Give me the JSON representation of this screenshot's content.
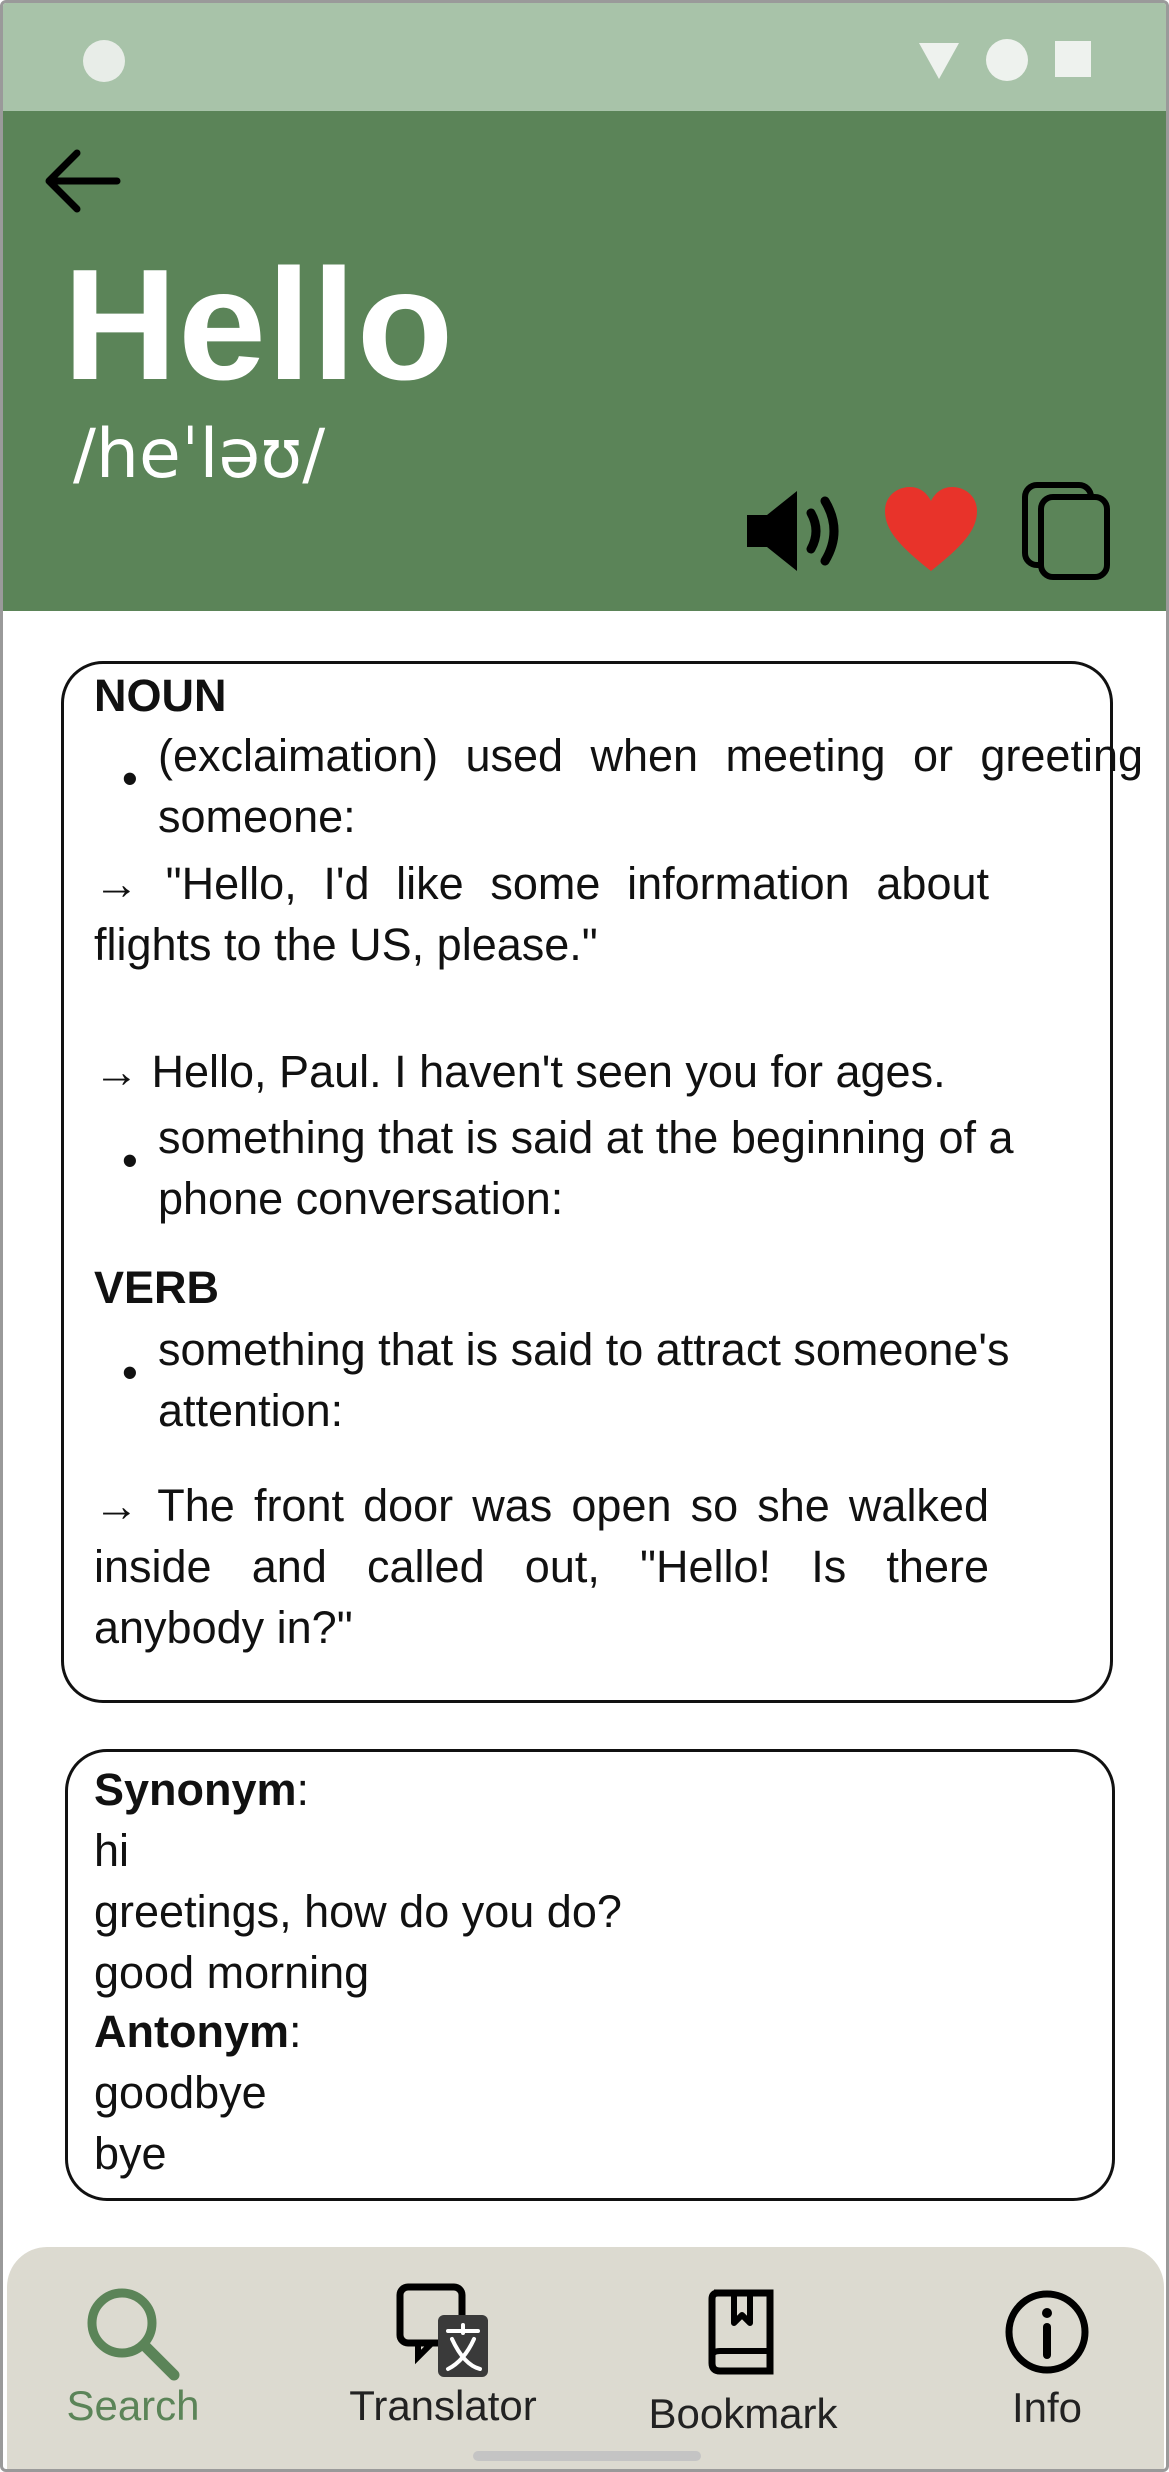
{
  "header": {
    "word": "Hello",
    "phonetic": "/heˈləʊ/",
    "back_icon": "arrow-left-icon",
    "actions": [
      {
        "name": "speaker-icon"
      },
      {
        "name": "heart-icon",
        "color": "#e8332a"
      },
      {
        "name": "copy-icon"
      }
    ]
  },
  "definitions": {
    "noun_label": "NOUN",
    "noun_def1": "(exclaimation) used when meeting or greeting someone:",
    "noun_ex1": "→ \"Hello, I'd like some information about flights to the US, please.\"",
    "noun_ex2": "→ Hello, Paul. I haven't seen you for ages.",
    "noun_def2": "something that is said at the beginning of a phone conversation:",
    "verb_label": "VERB",
    "verb_def1": "something that is said to attract someone's attention:",
    "verb_ex1": "→ The front door was open so she walked inside and called out, \"Hello! Is there anybody in?\""
  },
  "related": {
    "synonym_label": "Synonym",
    "synonyms": [
      "hi",
      "greetings, how do you do?",
      "good morning"
    ],
    "antonym_label": "Antonym",
    "antonyms": [
      "goodbye",
      "bye"
    ],
    "separator": ":"
  },
  "nav": {
    "items": [
      {
        "label": "Search",
        "icon": "search-icon",
        "active": true
      },
      {
        "label": "Translator",
        "icon": "translator-icon",
        "active": false
      },
      {
        "label": "Bookmark",
        "icon": "bookmark-icon",
        "active": false
      },
      {
        "label": "Info",
        "icon": "info-icon",
        "active": false
      }
    ]
  },
  "colors": {
    "status_bar": "#a8c3a9",
    "header": "#5b8458",
    "accent": "#5b8458",
    "nav_bg": "#dcdad0"
  }
}
